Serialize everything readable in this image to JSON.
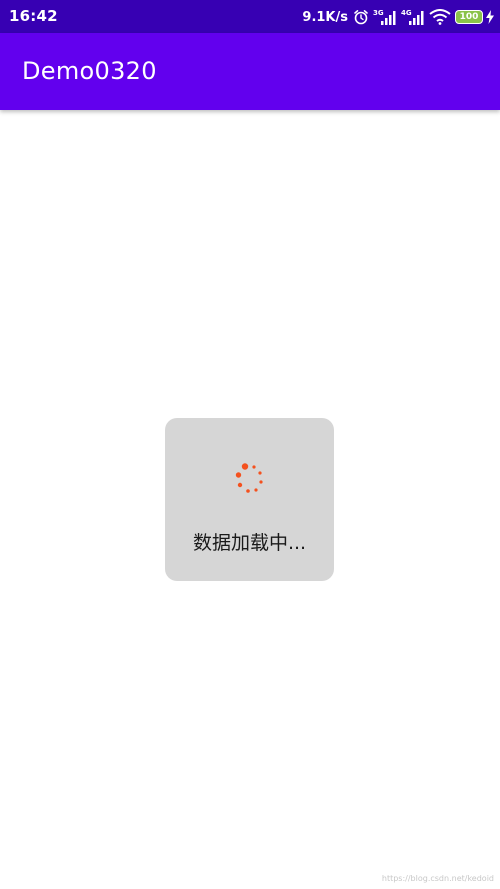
{
  "status_bar": {
    "time": "16:42",
    "net_speed": "9.1K/s",
    "battery_level": "100",
    "icons": [
      "alarm-icon",
      "signal-3g-icon",
      "signal-4g-icon",
      "wifi-icon",
      "battery-icon",
      "charging-icon"
    ],
    "network_label_1": "3G",
    "network_label_2": "4G",
    "color": "#3700b3"
  },
  "app_bar": {
    "title": "Demo0320",
    "color": "#6200ee"
  },
  "dialog": {
    "message": "数据加载中...",
    "background": "#d6d6d6",
    "spinner_color": "#f4511e"
  },
  "watermark": {
    "text": "https://blog.csdn.net/kedoid"
  }
}
